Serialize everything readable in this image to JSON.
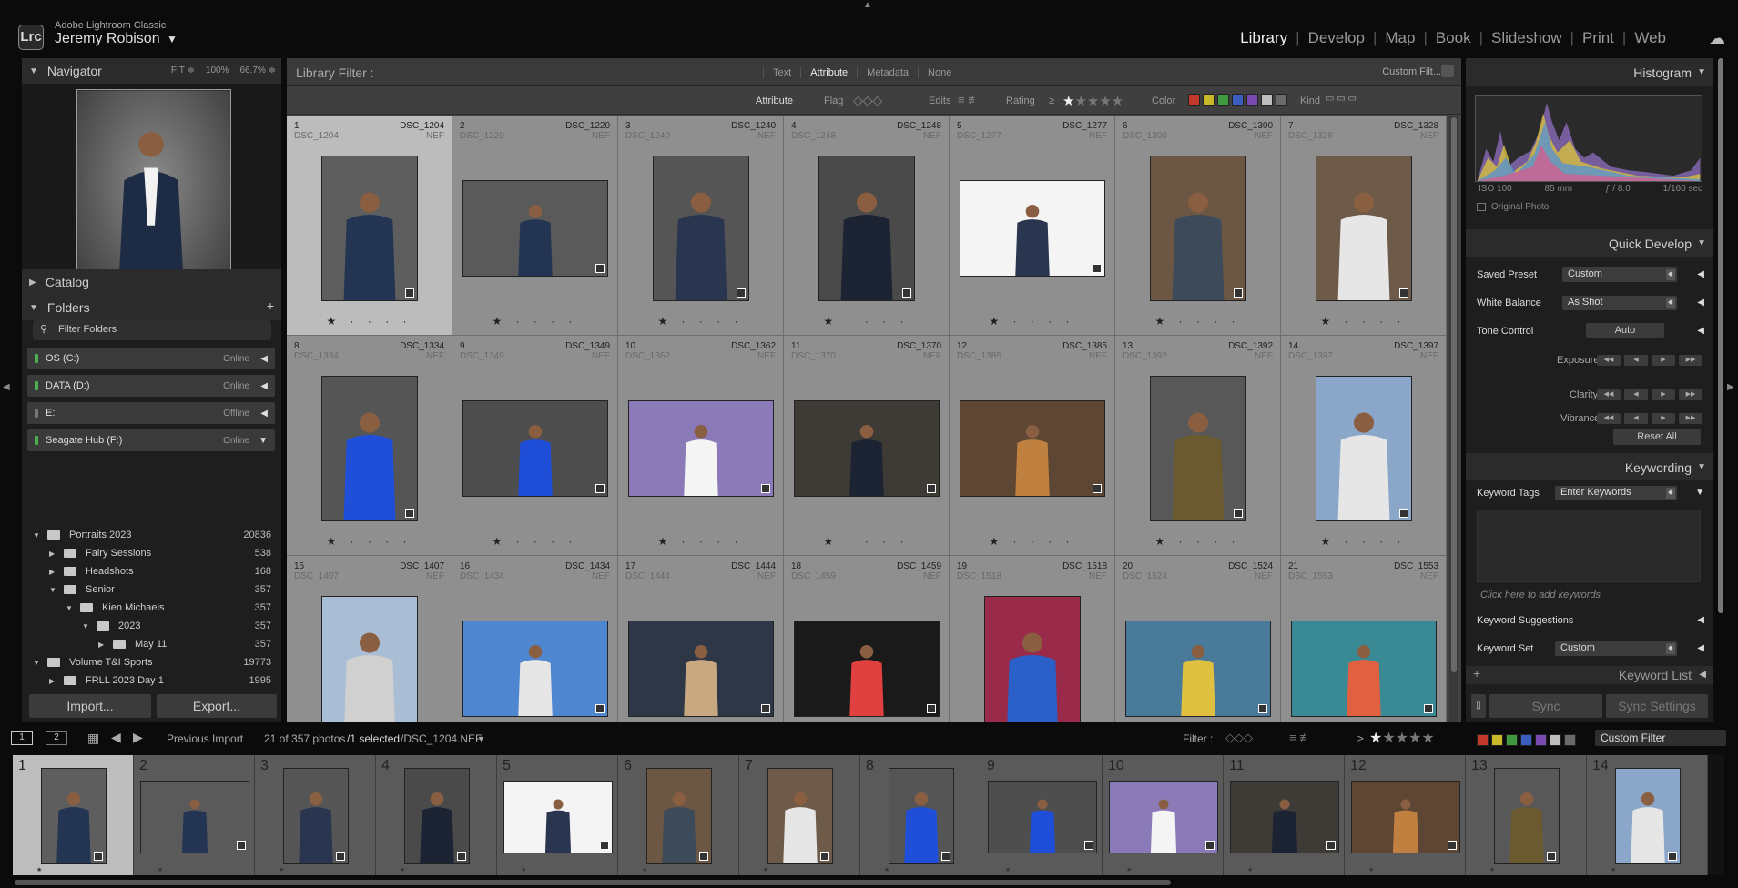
{
  "app": {
    "logo": "Lrc",
    "name": "Adobe Lightroom Classic",
    "user": "Jeremy Robison",
    "user_caret": "▼"
  },
  "modules": {
    "library": "Library",
    "develop": "Develop",
    "map": "Map",
    "book": "Book",
    "slideshow": "Slideshow",
    "print": "Print",
    "web": "Web",
    "active": "Library"
  },
  "navigator": {
    "title": "Navigator",
    "fit": "FIT ≑",
    "z100": "100%",
    "z667": "66.7% ≑"
  },
  "catalog": {
    "title": "Catalog"
  },
  "folders": {
    "title": "Folders",
    "add": "+",
    "filter_placeholder": "Filter Folders",
    "volumes": [
      {
        "name": "OS (C:)",
        "status": "Online",
        "led": "#4caf50"
      },
      {
        "name": "DATA (D:)",
        "status": "Online",
        "led": "#4caf50"
      },
      {
        "name": "E:",
        "status": "Offline",
        "led": "#777777"
      },
      {
        "name": "Seagate Hub (F:)",
        "status": "Online",
        "led": "#4caf50"
      }
    ],
    "tree": [
      {
        "name": "Portraits 2023",
        "count": "20836",
        "depth": 0
      },
      {
        "name": "Fairy Sessions",
        "count": "538",
        "depth": 1
      },
      {
        "name": "Headshots",
        "count": "168",
        "depth": 1
      },
      {
        "name": "Senior",
        "count": "357",
        "depth": 1
      },
      {
        "name": "Kien Michaels",
        "count": "357",
        "depth": 2
      },
      {
        "name": "2023",
        "count": "357",
        "depth": 3
      },
      {
        "name": "May 11",
        "count": "357",
        "depth": 4
      },
      {
        "name": "Volume T&I Sports",
        "count": "19773",
        "depth": 0
      },
      {
        "name": "FRLL 2023 Day 1",
        "count": "1995",
        "depth": 1
      }
    ]
  },
  "buttons": {
    "import": "Import...",
    "export": "Export...",
    "sync": "Sync",
    "sync_settings": "Sync Settings",
    "reset_all": "Reset All",
    "auto": "Auto"
  },
  "library_filter": {
    "title": "Library Filter :",
    "tabs": [
      "Text",
      "Attribute",
      "Metadata",
      "None"
    ],
    "active_tab": "Attribute",
    "preset": "Custom Filt...",
    "attr_label": "Attribute",
    "flag": "Flag",
    "edits": "Edits",
    "rating": "Rating",
    "rating_op": "≥",
    "color": "Color",
    "kind": "Kind",
    "colors": [
      "#c0392b",
      "#c8b82a",
      "#3f9a3f",
      "#3a5fc0",
      "#7a4ab0",
      "#bdbdbd",
      "#6a6a6a"
    ]
  },
  "grid": [
    {
      "i": "1",
      "name": "DSC_1204",
      "ext": "NEF",
      "stars": "★ · · · ·",
      "orient": "p",
      "bg": "#5e5e5e",
      "fig": "#233552",
      "sel": true
    },
    {
      "i": "2",
      "name": "DSC_1220",
      "ext": "NEF",
      "stars": "★ · · · ·",
      "orient": "l",
      "bg": "#5a5a5a",
      "fig": "#233552"
    },
    {
      "i": "3",
      "name": "DSC_1240",
      "ext": "NEF",
      "stars": "★ · · · ·",
      "orient": "p",
      "bg": "#555555",
      "fig": "#2a3550"
    },
    {
      "i": "4",
      "name": "DSC_1248",
      "ext": "NEF",
      "stars": "★ · · · ·",
      "orient": "p",
      "bg": "#4a4a4a",
      "fig": "#1c2333"
    },
    {
      "i": "5",
      "name": "DSC_1277",
      "ext": "NEF",
      "stars": "★ · · · ·",
      "orient": "l",
      "bg": "#f4f4f4",
      "fig": "#2a3550"
    },
    {
      "i": "6",
      "name": "DSC_1300",
      "ext": "NEF",
      "stars": "★ · · · ·",
      "orient": "p",
      "bg": "#6b5744",
      "fig": "#3c4a5a"
    },
    {
      "i": "7",
      "name": "DSC_1328",
      "ext": "NEF",
      "stars": "★ · · · ·",
      "orient": "p",
      "bg": "#6e5a48",
      "fig": "#e6e6e6"
    },
    {
      "i": "8",
      "name": "DSC_1334",
      "ext": "NEF",
      "stars": "★ · · · ·",
      "orient": "p",
      "bg": "#555555",
      "fig": "#1f4fd8"
    },
    {
      "i": "9",
      "name": "DSC_1349",
      "ext": "NEF",
      "stars": "★ · · · ·",
      "orient": "l",
      "bg": "#4e4e4e",
      "fig": "#1f4fd8"
    },
    {
      "i": "10",
      "name": "DSC_1362",
      "ext": "NEF",
      "stars": "★ · · · ·",
      "orient": "l",
      "bg": "#8a7bb8",
      "fig": "#f4f4f4"
    },
    {
      "i": "11",
      "name": "DSC_1370",
      "ext": "NEF",
      "stars": "★ · · · ·",
      "orient": "l",
      "bg": "#3e3a36",
      "fig": "#1c2333"
    },
    {
      "i": "12",
      "name": "DSC_1385",
      "ext": "NEF",
      "stars": "★ · · · ·",
      "orient": "l",
      "bg": "#5e4634",
      "fig": "#c08040"
    },
    {
      "i": "13",
      "name": "DSC_1392",
      "ext": "NEF",
      "stars": "★ · · · ·",
      "orient": "p",
      "bg": "#585858",
      "fig": "#6b5a30"
    },
    {
      "i": "14",
      "name": "DSC_1397",
      "ext": "NEF",
      "stars": "★ · · · ·",
      "orient": "p",
      "bg": "#8aa6c8",
      "fig": "#e6e6e6"
    },
    {
      "i": "15",
      "name": "DSC_1407",
      "ext": "NEF",
      "stars": "",
      "orient": "p",
      "bg": "#a9bdd4",
      "fig": "#d0d0d0"
    },
    {
      "i": "16",
      "name": "DSC_1434",
      "ext": "NEF",
      "stars": "",
      "orient": "l",
      "bg": "#4f86d0",
      "fig": "#e6e6e6"
    },
    {
      "i": "17",
      "name": "DSC_1444",
      "ext": "NEF",
      "stars": "",
      "orient": "l",
      "bg": "#2d3746",
      "fig": "#c8a880"
    },
    {
      "i": "18",
      "name": "DSC_1459",
      "ext": "NEF",
      "stars": "",
      "orient": "l",
      "bg": "#1a1a1a",
      "fig": "#e04040"
    },
    {
      "i": "19",
      "name": "DSC_1518",
      "ext": "NEF",
      "stars": "",
      "orient": "p",
      "bg": "#9a2a4a",
      "fig": "#2a60c8"
    },
    {
      "i": "20",
      "name": "DSC_1524",
      "ext": "NEF",
      "stars": "",
      "orient": "l",
      "bg": "#4a7a9a",
      "fig": "#e0c040"
    },
    {
      "i": "21",
      "name": "DSC_1553",
      "ext": "NEF",
      "stars": "",
      "orient": "l",
      "bg": "#3a8a96",
      "fig": "#e06040"
    }
  ],
  "histogram": {
    "title": "Histogram",
    "iso": "ISO 100",
    "focal": "85 mm",
    "aperture": "ƒ / 8.0",
    "shutter": "1/160 sec",
    "original_photo": "Original Photo"
  },
  "quick_develop": {
    "title": "Quick Develop",
    "saved_preset_label": "Saved Preset",
    "saved_preset": "Custom",
    "wb_label": "White Balance",
    "wb": "As Shot",
    "tone_label": "Tone Control",
    "exposure": "Exposure",
    "clarity": "Clarity",
    "vibrance": "Vibrance"
  },
  "keywording": {
    "title": "Keywording",
    "tags_label": "Keyword Tags",
    "tags_value": "Enter Keywords",
    "hint": "Click here to add keywords",
    "suggestions": "Keyword Suggestions",
    "set_label": "Keyword Set",
    "set_value": "Custom"
  },
  "keyword_list": {
    "title": "Keyword List"
  },
  "filmstrip_bar": {
    "p1": "1",
    "p2": "2",
    "source": "Previous Import",
    "count": "21 of 357 photos",
    "selected": "/1 selected",
    "file": "/DSC_1204.NEF",
    "filter_label": "Filter :",
    "rating_op": "≥",
    "filter_preset": "Custom Filter"
  },
  "filmstrip": [
    "1",
    "2",
    "3",
    "4",
    "5",
    "6",
    "7",
    "8",
    "9",
    "10",
    "11",
    "12",
    "13",
    "14"
  ]
}
